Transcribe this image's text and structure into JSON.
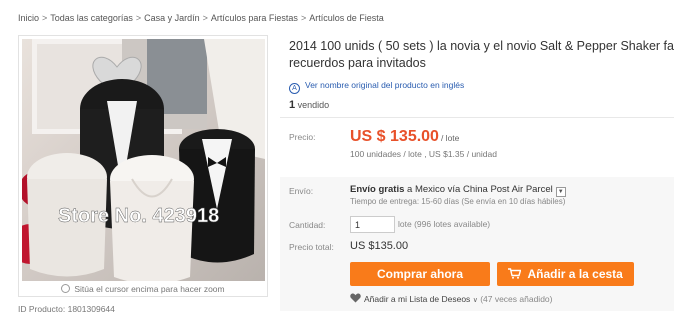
{
  "breadcrumb": {
    "items": [
      "Inicio",
      "Todas las categorías",
      "Casa y Jardín",
      "Artículos para Fiestas",
      "Artículos de Fiesta"
    ],
    "separator": ">"
  },
  "gallery": {
    "watermark": "Store No. 423918",
    "zoom_hint": "Sitúa el cursor encima para hacer zoom",
    "product_id": "ID Producto: 1801309644"
  },
  "product": {
    "title_line1": "2014 100 unids ( 50 sets ) la novia y el novio Salt & Pepper Shaker fa",
    "title_line2": "recuerdos para invitados",
    "original_link": "Ver nombre original del producto en inglés",
    "sold_count": "1",
    "sold_label": "vendido"
  },
  "price": {
    "label": "Precio:",
    "value": "US $ 135.00",
    "unit": "/ lote",
    "detail": "100 unidades / lote , US $1.35 / unidad"
  },
  "shipping": {
    "label": "Envío:",
    "free": "Envío gratis",
    "dest": "a Mexico vía China Post Air Parcel",
    "eta": "Tiempo de entrega: 15-60 días (Se envía en 10 días hábiles)"
  },
  "quantity": {
    "label": "Cantidad:",
    "value": "1",
    "info": "lote (996 lotes available)"
  },
  "total": {
    "label": "Precio total:",
    "value": "US $135.00"
  },
  "actions": {
    "buy_now": "Comprar ahora",
    "add_to_cart": "Añadir a la cesta",
    "wishlist": "Añadir a mi Lista de Deseos",
    "wishlist_count": "(47 veces añadido)"
  },
  "colors": {
    "accent": "#f97b1a",
    "price": "#e8512a",
    "link": "#2a5db0"
  }
}
